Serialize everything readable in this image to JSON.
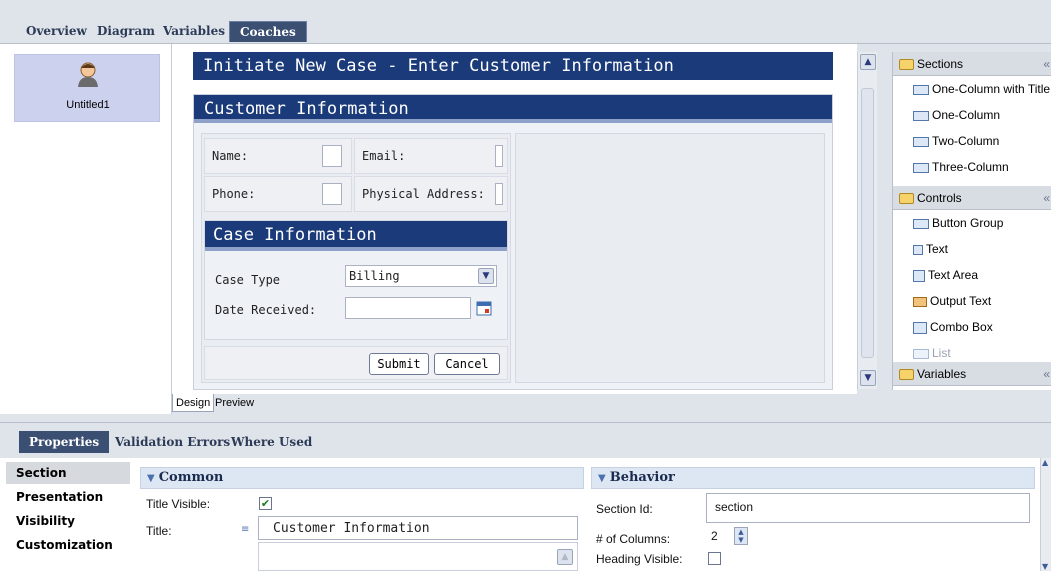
{
  "top_tabs": [
    "Overview",
    "Diagram",
    "Variables",
    "Coaches"
  ],
  "coach_list": {
    "item_label": "Untitled1"
  },
  "canvas": {
    "page_title": "Initiate New Case -  Enter Customer Information",
    "customer_section": {
      "title": "Customer Information",
      "fields": [
        {
          "label": "Name:"
        },
        {
          "label": "Email:"
        },
        {
          "label": "Phone:"
        },
        {
          "label": "Physical Address:"
        }
      ]
    },
    "case_section": {
      "title": "Case Information",
      "case_type_label": "Case Type",
      "case_type_value": "Billing",
      "date_label": "Date Received:",
      "date_value": ""
    },
    "buttons": {
      "submit": "Submit",
      "cancel": "Cancel"
    }
  },
  "design_tabs": [
    "Design",
    "Preview"
  ],
  "palette": {
    "sections_label": "Sections",
    "section_items": [
      "One-Column with Title",
      "One-Column",
      "Two-Column",
      "Three-Column"
    ],
    "controls_label": "Controls",
    "control_items": [
      "Button Group",
      "Text",
      "Text Area",
      "Output Text",
      "Combo Box",
      "List"
    ],
    "variables_label": "Variables",
    "collapse_glyph": "«"
  },
  "bottom_tabs": [
    "Properties",
    "Validation Errors",
    "Where Used"
  ],
  "props_nav": [
    "Section",
    "Presentation",
    "Visibility",
    "Customization"
  ],
  "common": {
    "header": "Common",
    "title_visible_label": "Title Visible:",
    "title_visible_checked": true,
    "title_label": "Title:",
    "title_value": "Customer Information"
  },
  "behavior": {
    "header": "Behavior",
    "section_id_label": "Section Id:",
    "section_id_value": "section",
    "columns_label": "# of Columns:",
    "columns_value": "2",
    "heading_visible_label": "Heading Visible:",
    "heading_visible_checked": false
  },
  "colors": {
    "accent": "#1a3a7a",
    "tab_active": "#3b4f72",
    "panel_bg": "#dfe3ea"
  }
}
